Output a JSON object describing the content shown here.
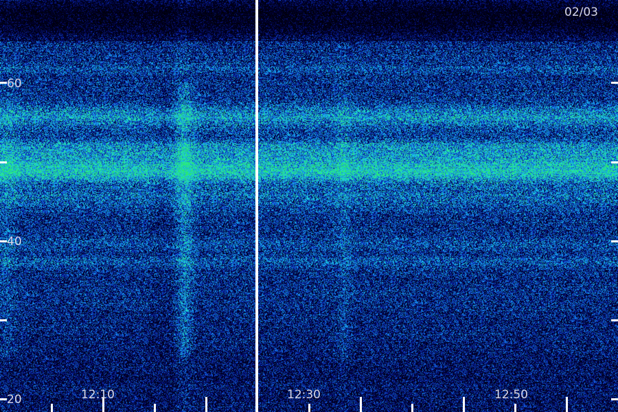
{
  "date_label": "02/03",
  "y_labels": [
    "60",
    "40",
    "20"
  ],
  "y_label_values": [
    60,
    40,
    20
  ],
  "y_tick_values": [
    80,
    70,
    60,
    50,
    40,
    30,
    20
  ],
  "y_range": [
    20,
    80
  ],
  "x_labels": [
    "12:10",
    "12:30",
    "12:50"
  ],
  "colors": {
    "background": "#00003a",
    "noise_low": "#0a1e96",
    "noise_mid": "#1e5fe6",
    "noise_high": "#1ecfe0",
    "band_highlight": "#28f0a0",
    "separator": "#ffffff",
    "tick": "#ffffff",
    "label": "#d8d8e8"
  }
}
